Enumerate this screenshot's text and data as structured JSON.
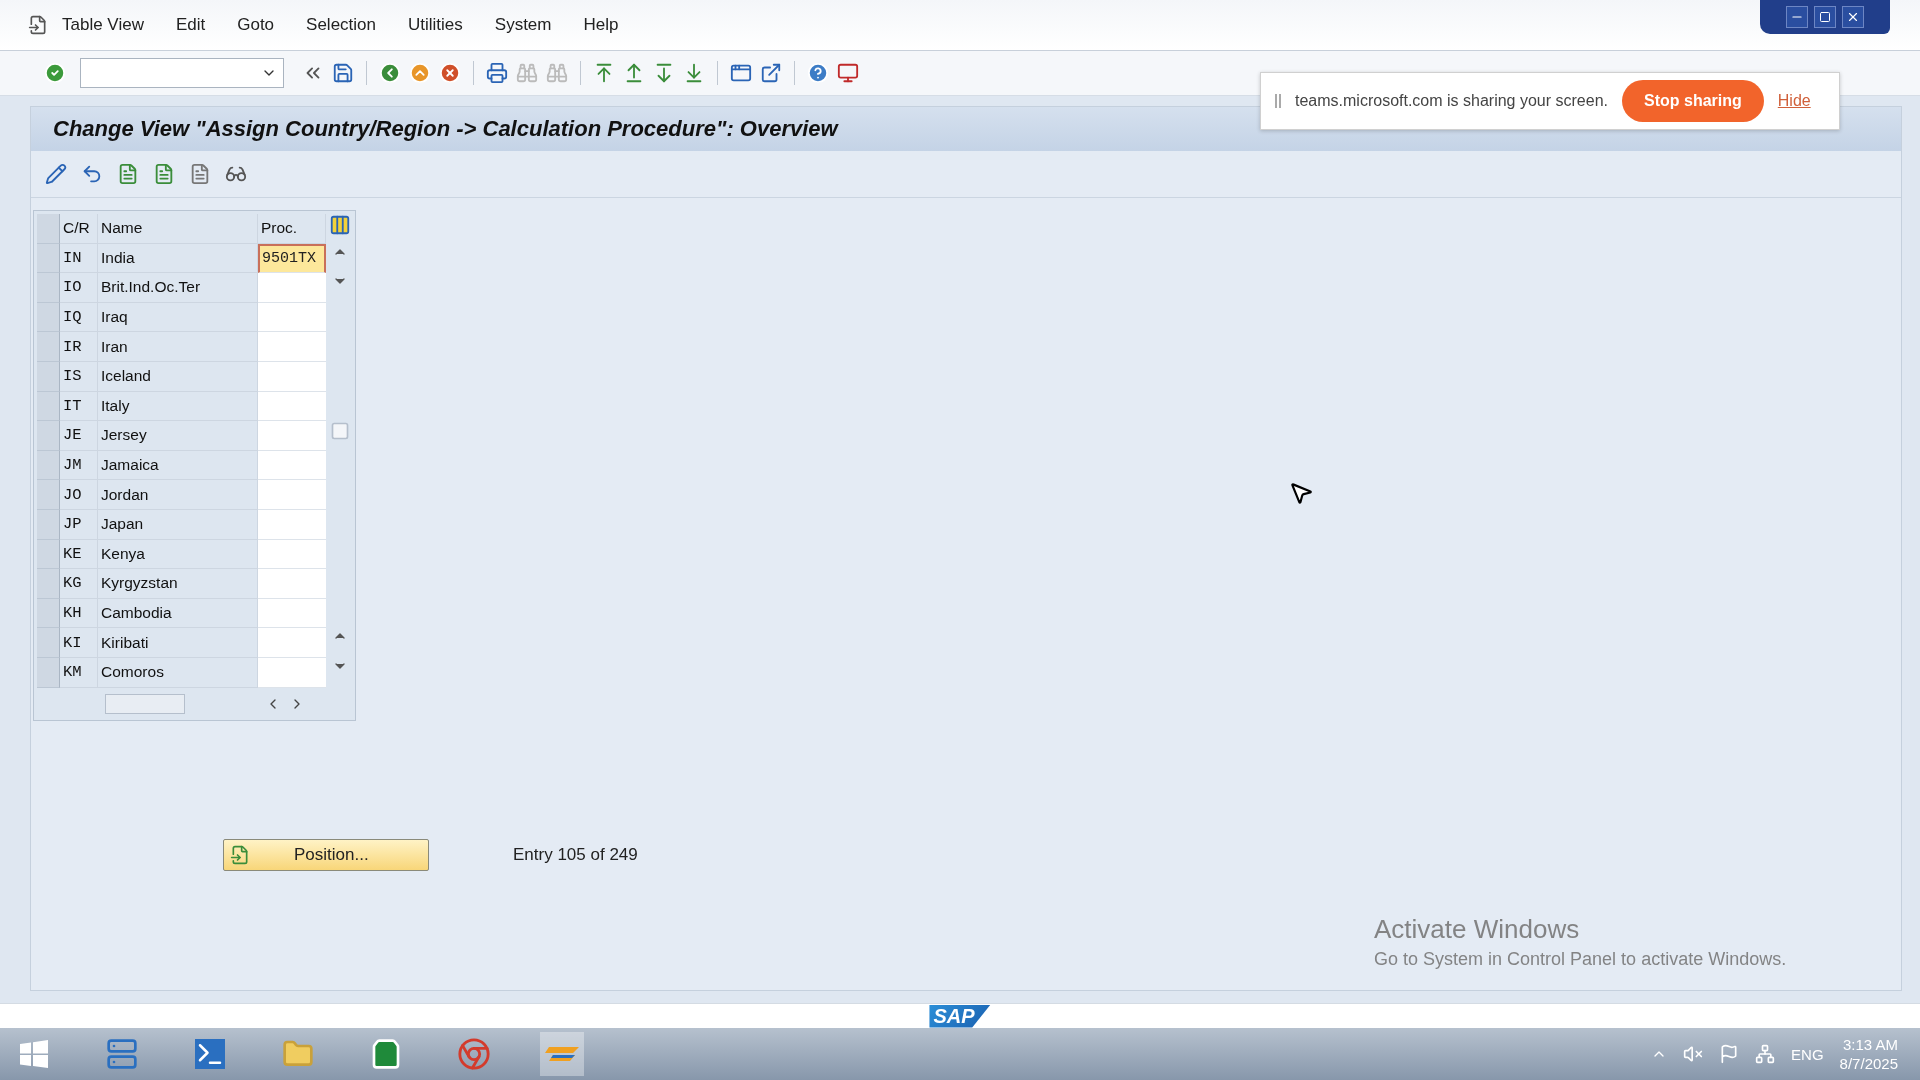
{
  "menu": [
    "Table View",
    "Edit",
    "Goto",
    "Selection",
    "Utilities",
    "System",
    "Help"
  ],
  "title": "Change View \"Assign Country/Region -> Calculation Procedure\": Overview",
  "table": {
    "columns": [
      "C/R",
      "Name",
      "Proc."
    ],
    "rows": [
      {
        "cr": "IN",
        "name": "India",
        "proc": "9501TX",
        "focused": true
      },
      {
        "cr": "IO",
        "name": "Brit.Ind.Oc.Ter",
        "proc": "",
        "focused": false
      },
      {
        "cr": "IQ",
        "name": "Iraq",
        "proc": "",
        "focused": false
      },
      {
        "cr": "IR",
        "name": "Iran",
        "proc": "",
        "focused": false
      },
      {
        "cr": "IS",
        "name": "Iceland",
        "proc": "",
        "focused": false
      },
      {
        "cr": "IT",
        "name": "Italy",
        "proc": "",
        "focused": false
      },
      {
        "cr": "JE",
        "name": "Jersey",
        "proc": "",
        "focused": false
      },
      {
        "cr": "JM",
        "name": "Jamaica",
        "proc": "",
        "focused": false
      },
      {
        "cr": "JO",
        "name": "Jordan",
        "proc": "",
        "focused": false
      },
      {
        "cr": "JP",
        "name": "Japan",
        "proc": "",
        "focused": false
      },
      {
        "cr": "KE",
        "name": "Kenya",
        "proc": "",
        "focused": false
      },
      {
        "cr": "KG",
        "name": "Kyrgyzstan",
        "proc": "",
        "focused": false
      },
      {
        "cr": "KH",
        "name": "Cambodia",
        "proc": "",
        "focused": false
      },
      {
        "cr": "KI",
        "name": "Kiribati",
        "proc": "",
        "focused": false
      },
      {
        "cr": "KM",
        "name": "Comoros",
        "proc": "",
        "focused": false
      }
    ]
  },
  "position_button": "Position...",
  "entry_info": "Entry 105 of 249",
  "sharing_banner": {
    "text": "teams.microsoft.com is sharing your screen.",
    "stop_button": "Stop sharing",
    "hide_link": "Hide"
  },
  "activation_notice": {
    "title": "Activate Windows",
    "text": "Go to System in Control Panel to activate Windows."
  },
  "logo": "SAP",
  "taskbar": {
    "language": "ENG",
    "time": "3:13 AM",
    "date": "8/7/2025"
  }
}
